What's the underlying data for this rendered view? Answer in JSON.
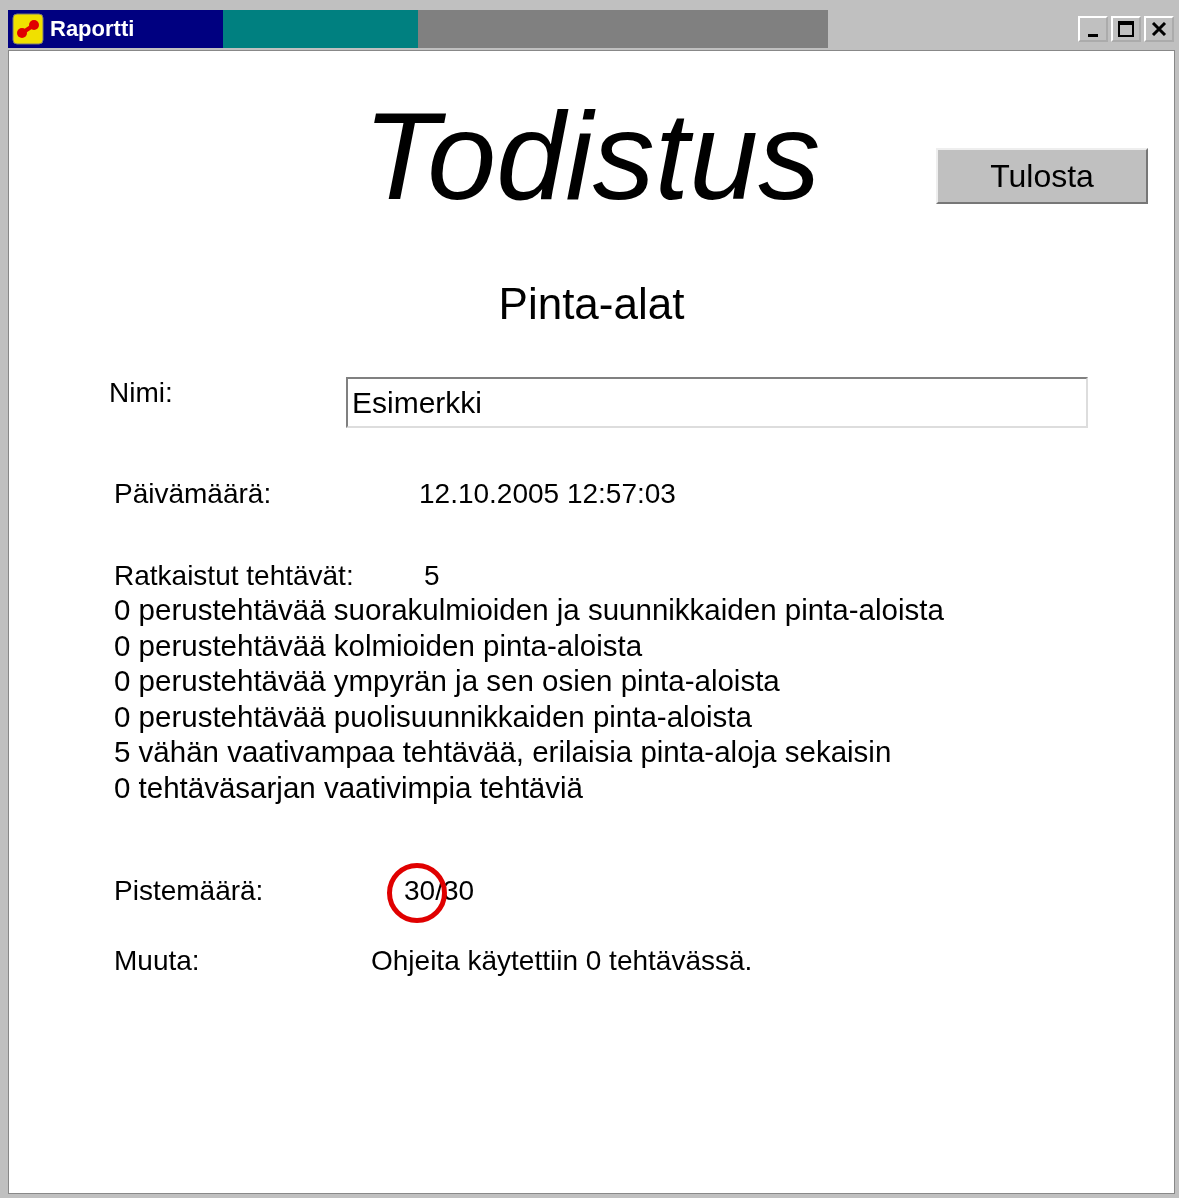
{
  "window": {
    "title": "Raportti"
  },
  "heading": "Todistus",
  "print_button": "Tulosta",
  "subject": "Pinta-alat",
  "name_field": {
    "label": "Nimi:",
    "value": "Esimerkki"
  },
  "date": {
    "label": "Päivämäärä:",
    "value": "12.10.2005 12:57:03"
  },
  "solved": {
    "label": "Ratkaistut tehtävät:",
    "value": "5"
  },
  "task_lines": [
    "0 perustehtävää suorakulmioiden ja suunnikkaiden pinta-aloista",
    "0 perustehtävää kolmioiden pinta-aloista",
    "0 perustehtävää ympyrän ja sen osien pinta-aloista",
    "0 perustehtävää puolisuunnikkaiden pinta-aloista",
    "5 vähän vaativampaa tehtävää, erilaisia pinta-aloja sekaisin",
    "0 tehtäväsarjan vaativimpia tehtäviä"
  ],
  "score": {
    "label": "Pistemäärä:",
    "value": "30/30",
    "circled": true
  },
  "other": {
    "label": "Muuta:",
    "value": "Ohjeita käytettiin 0 tehtävässä."
  }
}
